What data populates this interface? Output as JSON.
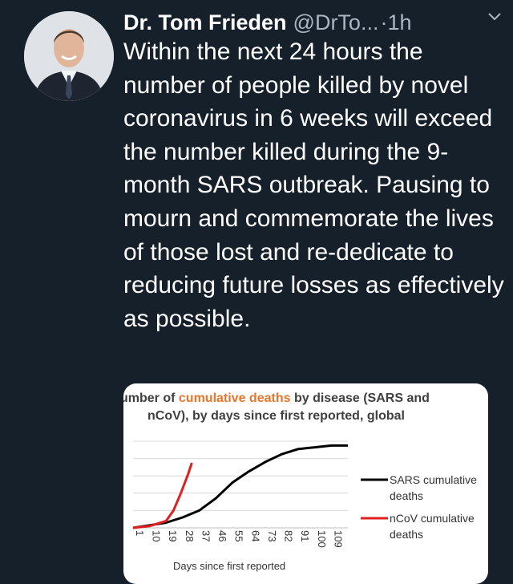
{
  "tweet": {
    "author_name": "Dr. Tom Frieden",
    "handle": "@DrTo...",
    "time": "·1h",
    "text": "Within the next 24 hours the number of people killed by novel coronavirus in 6 weeks will exceed the number killed during the 9-month SARS outbreak. Pausing to mourn and commemorate the lives of those lost and re-dedicate to reducing future losses as effectively as possible."
  },
  "card": {
    "title_pre": "umber of ",
    "title_highlight": "cumulative deaths",
    "title_post": " by disease (SARS and",
    "title_line2": "nCoV), by days since first reported, global",
    "highlight_color": "#e8752a"
  },
  "chart_data": {
    "type": "line",
    "x_ticks": [
      "1",
      "10",
      "19",
      "28",
      "37",
      "46",
      "55",
      "64",
      "73",
      "82",
      "91",
      "100",
      "109"
    ],
    "xlabel": "Days since first reported",
    "grid": true,
    "legend_position": "right",
    "series": [
      {
        "name": "SARS cumulative deaths",
        "color": "#000000",
        "points": [
          [
            1,
            0
          ],
          [
            10,
            3
          ],
          [
            19,
            6
          ],
          [
            28,
            12
          ],
          [
            37,
            20
          ],
          [
            46,
            34
          ],
          [
            55,
            52
          ],
          [
            64,
            65
          ],
          [
            73,
            76
          ],
          [
            82,
            85
          ],
          [
            91,
            91
          ],
          [
            100,
            93
          ],
          [
            109,
            95
          ],
          [
            118,
            95
          ]
        ]
      },
      {
        "name": "nCoV cumulative deaths",
        "color": "#e02020",
        "points": [
          [
            1,
            0
          ],
          [
            10,
            2
          ],
          [
            19,
            8
          ],
          [
            23,
            20
          ],
          [
            27,
            40
          ],
          [
            31,
            62
          ],
          [
            33,
            75
          ]
        ]
      }
    ]
  }
}
